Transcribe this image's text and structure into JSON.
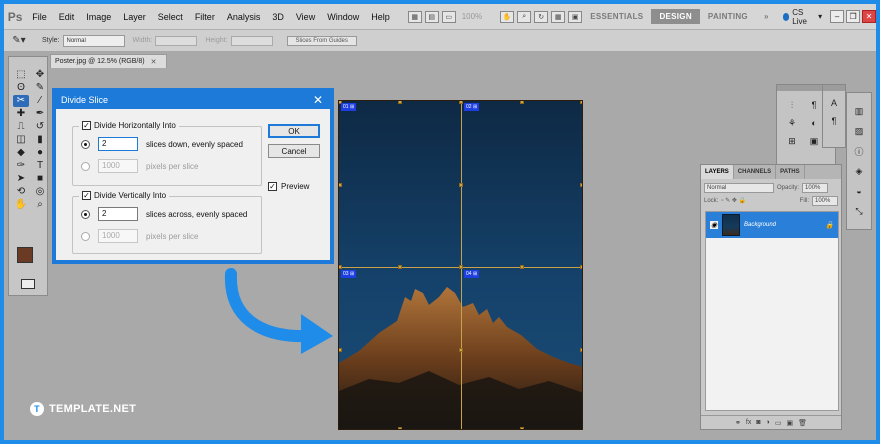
{
  "app": {
    "logo": "Ps"
  },
  "menu": [
    "File",
    "Edit",
    "Image",
    "Layer",
    "Select",
    "Filter",
    "Analysis",
    "3D",
    "View",
    "Window",
    "Help"
  ],
  "menubar": {
    "zoom": "100%",
    "workspaces": [
      "ESSENTIALS",
      "DESIGN",
      "PAINTING"
    ],
    "active_workspace": "DESIGN",
    "more": "»",
    "cslive": "CS Live"
  },
  "optbar": {
    "style_label": "Style:",
    "style_value": "Normal",
    "width_label": "Width:",
    "height_label": "Height:",
    "slices_button": "Slices From Guides"
  },
  "document": {
    "tab_title": "Poster.jpg @ 12.5% (RGB/8)"
  },
  "dialog": {
    "title": "Divide Slice",
    "horizontal": {
      "label": "Divide Horizontally Into",
      "count": "2",
      "count_suffix": "slices down, evenly spaced",
      "pixels": "1000",
      "pixels_suffix": "pixels per slice"
    },
    "vertical": {
      "label": "Divide Vertically Into",
      "count": "2",
      "count_suffix": "slices across, evenly spaced",
      "pixels": "1000",
      "pixels_suffix": "pixels per slice"
    },
    "ok": "OK",
    "cancel": "Cancel",
    "preview": "Preview"
  },
  "slices": [
    "01",
    "02",
    "03",
    "04"
  ],
  "layers_panel": {
    "tabs": [
      "LAYERS",
      "CHANNELS",
      "PATHS"
    ],
    "blend_mode": "Normal",
    "opacity_label": "Opacity:",
    "opacity": "100%",
    "lock_label": "Lock:",
    "fill_label": "Fill:",
    "fill": "100%",
    "layer_name": "Background"
  },
  "watermark": {
    "text": "TEMPLATE.NET"
  },
  "colors": {
    "accent": "#1d7ad8",
    "foreground": "#6a3a24",
    "background_swatch": "#d8e4f4"
  }
}
